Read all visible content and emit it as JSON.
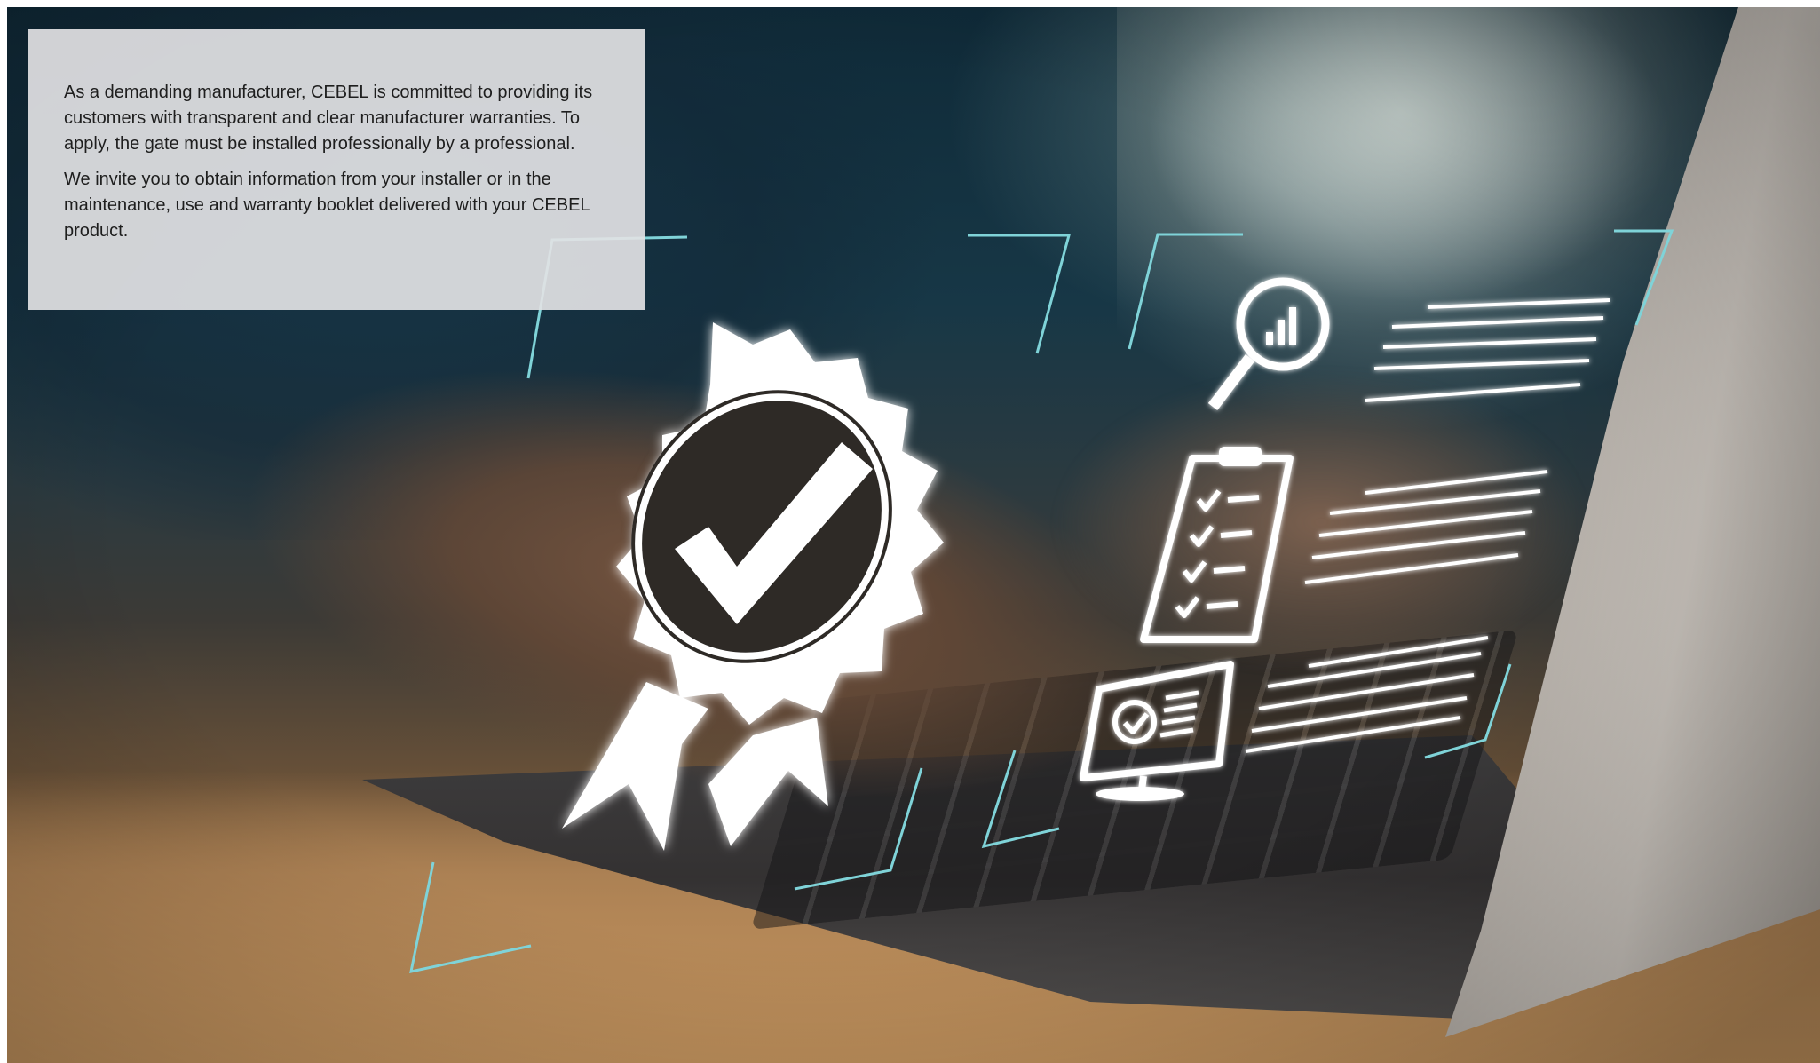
{
  "info_panel": {
    "paragraph_1": "As a demanding manufacturer, CEBEL is committed to providing its customers with transparent and clear manufacturer warranties. To apply, the gate must be installed professionally by a professional.",
    "paragraph_2": "We invite you to obtain information from your installer or in the maintenance, use and warranty booklet delivered with your CEBEL product."
  },
  "graphics": {
    "badge_icon": "award-ribbon-checkmark-icon",
    "search_icon": "magnifier-bar-chart-icon",
    "clipboard_icon": "checklist-clipboard-icon",
    "monitor_icon": "monitor-checkmark-icon",
    "accent_color": "#7fd3d8",
    "icon_color": "#ffffff"
  }
}
